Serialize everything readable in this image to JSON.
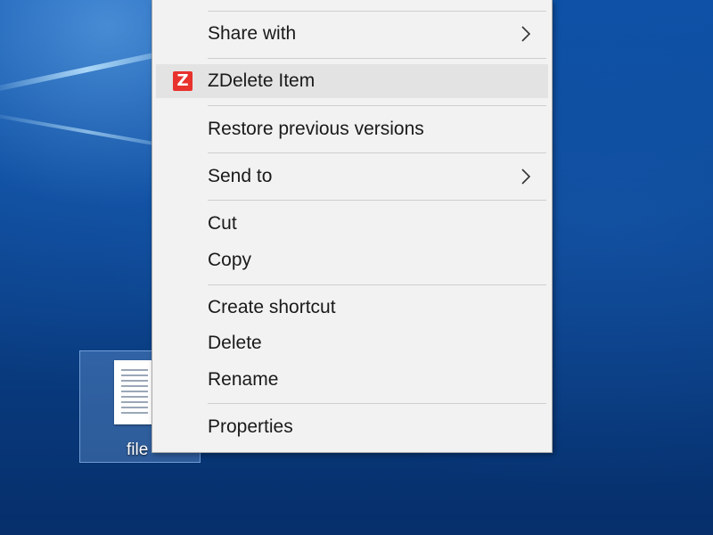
{
  "desktop": {
    "icon_label": "file"
  },
  "menu": {
    "items": [
      {
        "label": "Share with",
        "submenu": true
      },
      {
        "label": "ZDelete Item",
        "icon": "zdelete-icon",
        "highlighted": true
      },
      {
        "label": "Restore previous versions"
      },
      {
        "label": "Send to",
        "submenu": true
      },
      {
        "label": "Cut"
      },
      {
        "label": "Copy"
      },
      {
        "label": "Create shortcut"
      },
      {
        "label": "Delete"
      },
      {
        "label": "Rename"
      },
      {
        "label": "Properties"
      }
    ]
  },
  "colors": {
    "desktop_bg": "#0a3f86",
    "menu_bg": "#f2f2f2",
    "highlight_bg": "#e3e3e3",
    "zdelete_brand": "#e8322e"
  }
}
